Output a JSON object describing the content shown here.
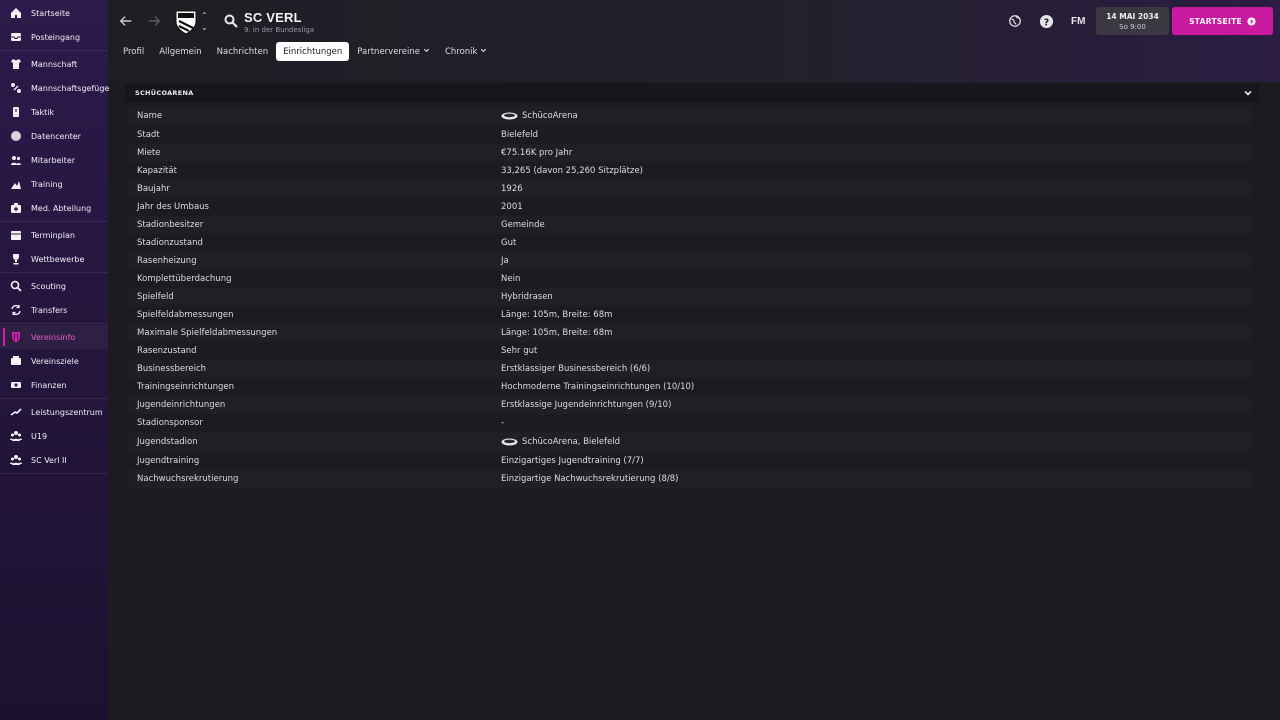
{
  "sidebar": {
    "groups": [
      [
        {
          "label": "Startseite",
          "icon": "home-icon"
        },
        {
          "label": "Posteingang",
          "icon": "inbox-icon"
        }
      ],
      [
        {
          "label": "Mannschaft",
          "icon": "shirt-icon"
        },
        {
          "label": "Mannschaftsgefüge",
          "icon": "dynamics-icon"
        },
        {
          "label": "Taktik",
          "icon": "tactics-icon"
        },
        {
          "label": "Datencenter",
          "icon": "data-icon"
        },
        {
          "label": "Mitarbeiter",
          "icon": "staff-icon"
        },
        {
          "label": "Training",
          "icon": "training-icon"
        },
        {
          "label": "Med. Abteilung",
          "icon": "medical-icon"
        }
      ],
      [
        {
          "label": "Terminplan",
          "icon": "calendar-icon"
        },
        {
          "label": "Wettbewerbe",
          "icon": "trophy-icon"
        }
      ],
      [
        {
          "label": "Scouting",
          "icon": "scouting-icon"
        },
        {
          "label": "Transfers",
          "icon": "transfers-icon"
        }
      ],
      [
        {
          "label": "Vereinsinfo",
          "icon": "shield-icon",
          "active": true
        },
        {
          "label": "Vereinsziele",
          "icon": "goals-icon"
        },
        {
          "label": "Finanzen",
          "icon": "finances-icon"
        }
      ],
      [
        {
          "label": "Leistungszentrum",
          "icon": "academy-icon"
        },
        {
          "label": "U19",
          "icon": "team-icon"
        },
        {
          "label": "SC Verl II",
          "icon": "team-icon"
        }
      ]
    ]
  },
  "header": {
    "club_name": "SC VERL",
    "subtitle": "9. in der Bundesliga",
    "fm_logo": "FM",
    "date": "14 MAI 2034",
    "time": "So 9:00",
    "continue_label": "STARTSEITE",
    "accent": "#c8199f"
  },
  "tabs": [
    {
      "label": "Profil"
    },
    {
      "label": "Allgemein"
    },
    {
      "label": "Nachrichten"
    },
    {
      "label": "Einrichtungen",
      "active": true
    },
    {
      "label": "Partnervereine",
      "dropdown": true
    },
    {
      "label": "Chronik",
      "dropdown": true
    }
  ],
  "panel": {
    "title": "SCHÜCOARENA",
    "rows": [
      {
        "key": "Name",
        "value": "SchücoArena",
        "icon": "stadium-icon"
      },
      {
        "key": "Stadt",
        "value": "Bielefeld"
      },
      {
        "key": "Miete",
        "value": "€75.16K pro Jahr"
      },
      {
        "key": "Kapazität",
        "value": "33,265 (davon 25,260 Sitzplätze)"
      },
      {
        "key": "Baujahr",
        "value": "1926"
      },
      {
        "key": "Jahr des Umbaus",
        "value": "2001"
      },
      {
        "key": "Stadionbesitzer",
        "value": "Gemeinde"
      },
      {
        "key": "Stadionzustand",
        "value": "Gut"
      },
      {
        "key": "Rasenheizung",
        "value": "Ja"
      },
      {
        "key": "Komplettüberdachung",
        "value": "Nein"
      },
      {
        "key": "Spielfeld",
        "value": "Hybridrasen"
      },
      {
        "key": "Spielfeldabmessungen",
        "value": "Länge: 105m, Breite: 68m"
      },
      {
        "key": "Maximale Spielfeldabmessungen",
        "value": "Länge: 105m, Breite: 68m"
      },
      {
        "key": "Rasenzustand",
        "value": "Sehr gut"
      },
      {
        "key": "Businessbereich",
        "value": "Erstklassiger Businessbereich (6/6)"
      },
      {
        "key": "Trainingseinrichtungen",
        "value": "Hochmoderne Trainingseinrichtungen (10/10)"
      },
      {
        "key": "Jugendeinrichtungen",
        "value": "Erstklassige Jugendeinrichtungen (9/10)"
      },
      {
        "key": "Stadionsponsor",
        "value": "-"
      },
      {
        "key": "Jugendstadion",
        "value": "SchücoArena, Bielefeld",
        "icon": "stadium-icon"
      },
      {
        "key": "Jugendtraining",
        "value": "Einzigartiges Jugendtraining (7/7)"
      },
      {
        "key": "Nachwuchsrekrutierung",
        "value": "Einzigartige Nachwuchsrekrutierung (8/8)"
      }
    ]
  }
}
